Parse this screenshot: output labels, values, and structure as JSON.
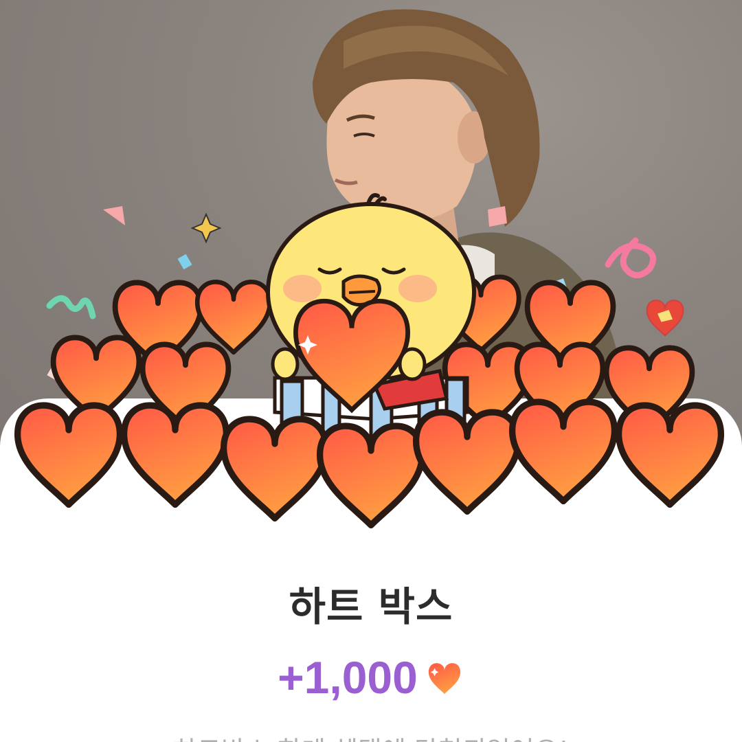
{
  "popup": {
    "title": "하트 박스",
    "reward_amount": "+1,000",
    "reward_icon": "heart-icon",
    "description": "하트박스 한데 혜택에 당첨되었어요!"
  },
  "colors": {
    "accent": "#9a5fd0",
    "heart_top": "#ff5a4a",
    "heart_bottom": "#ff9a40",
    "chick": "#fde67a"
  }
}
